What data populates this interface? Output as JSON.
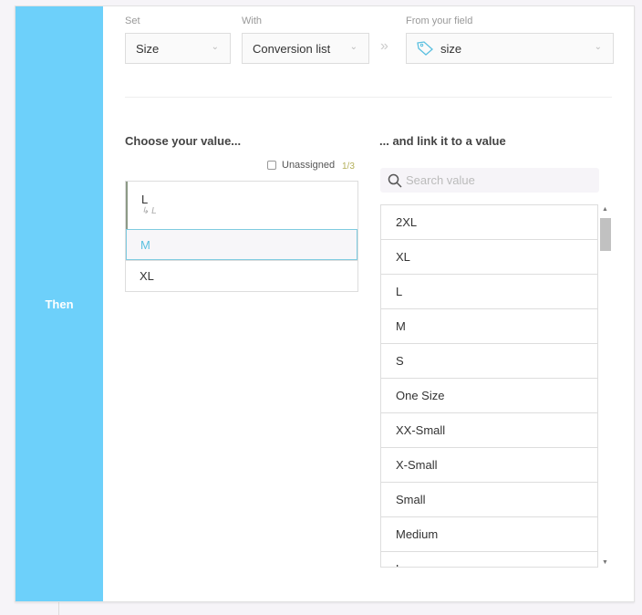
{
  "sidebar": {
    "label": "Then"
  },
  "set": {
    "label": "Set",
    "value": "Size"
  },
  "with": {
    "label": "With",
    "value": "Conversion list"
  },
  "field": {
    "label": "From your field",
    "value": "size",
    "icon": "tag-icon"
  },
  "left": {
    "title": "Choose your value...",
    "unassigned": "Unassigned",
    "count": "1/3",
    "items": [
      {
        "value": "L",
        "linked": "L"
      },
      {
        "value": "M"
      },
      {
        "value": "XL"
      }
    ]
  },
  "right": {
    "title": "... and link it to a value",
    "search_placeholder": "Search value",
    "items": [
      "2XL",
      "XL",
      "L",
      "M",
      "S",
      "One Size",
      "XX-Small",
      "X-Small",
      "Small",
      "Medium",
      "Large"
    ]
  },
  "colors": {
    "accent": "#6dd0fa"
  }
}
